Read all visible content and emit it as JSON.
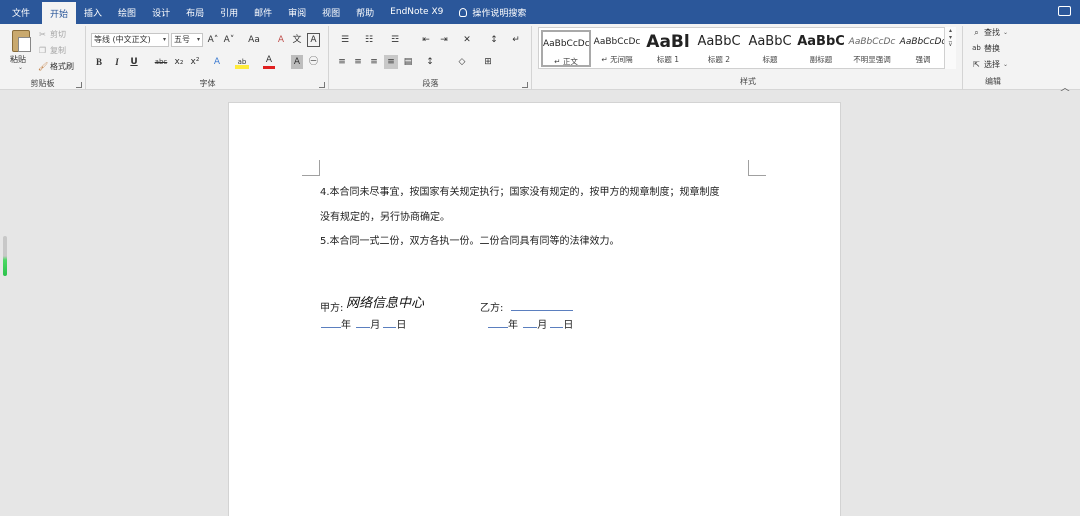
{
  "menu": {
    "tabs": [
      "文件",
      "开始",
      "插入",
      "绘图",
      "设计",
      "布局",
      "引用",
      "邮件",
      "审阅",
      "视图",
      "帮助",
      "EndNote X9"
    ],
    "active_tab": "开始",
    "tell_me": "操作说明搜索"
  },
  "ribbon": {
    "clipboard": {
      "paste": "粘贴",
      "cut": "剪切",
      "copy": "复制",
      "format_painter": "格式刷",
      "label": "剪贴板"
    },
    "font": {
      "font_name": "等线 (中文正文)",
      "font_size": "五号",
      "label": "字体",
      "bold": "B",
      "italic": "I",
      "underline": "U",
      "strike": "abc",
      "sub": "x₂",
      "sup": "x²",
      "grow": "A˄",
      "shrink": "A˅",
      "case": "Aa",
      "clear": "A",
      "phonetic": "文",
      "border_char": "A",
      "effects": "A",
      "highlight": "ab",
      "color": "A",
      "shade": "A",
      "enclose": "㊀"
    },
    "paragraph": {
      "label": "段落"
    },
    "styles": {
      "label": "样式",
      "items": [
        {
          "sample": "AaBbCcDc",
          "name": "↵ 正文"
        },
        {
          "sample": "AaBbCcDc",
          "name": "↵ 无间隔"
        },
        {
          "sample": "AaBl",
          "name": "标题 1"
        },
        {
          "sample": "AaBbC",
          "name": "标题 2"
        },
        {
          "sample": "AaBbC",
          "name": "标题"
        },
        {
          "sample": "AaBbC",
          "name": "副标题"
        },
        {
          "sample": "AaBbCcDc",
          "name": "不明显强调"
        },
        {
          "sample": "AaBbCcDc",
          "name": "强调"
        }
      ]
    },
    "editing": {
      "find": "查找",
      "replace": "替换",
      "select": "选择",
      "label": "编辑"
    }
  },
  "document": {
    "line1": "4.本合同未尽事宜，按国家有关规定执行；国家没有规定的，按甲方的规章制度；规章制度",
    "line2": "没有规定的，另行协商确定。",
    "line3": "5.本合同一式二份，双方各执一份。二份合同具有同等的法律效力。",
    "party_a_label": "甲方:",
    "party_a_signature": "网络信息中心",
    "party_b_label": "乙方:",
    "year": "年",
    "month": "月",
    "day": "日"
  }
}
